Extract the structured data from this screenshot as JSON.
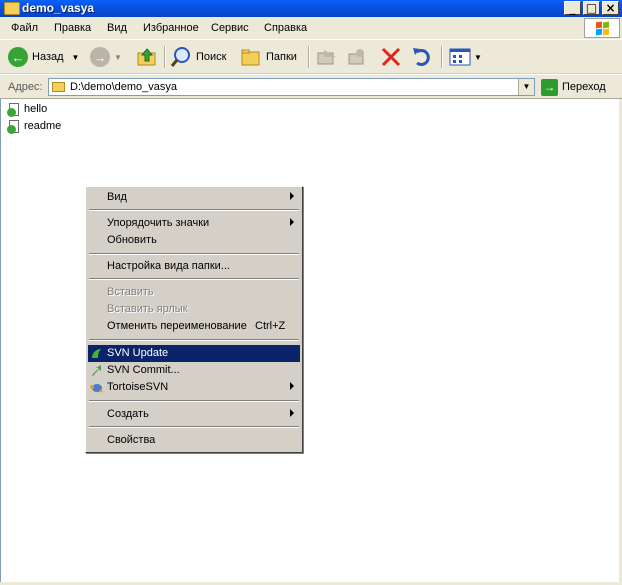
{
  "window": {
    "title": "demo_vasya"
  },
  "menubar": {
    "items": [
      "Файл",
      "Правка",
      "Вид",
      "Избранное",
      "Сервис",
      "Справка"
    ]
  },
  "toolbar": {
    "back_label": "Назад",
    "search_label": "Поиск",
    "folders_label": "Папки"
  },
  "address": {
    "label": "Адрес:",
    "value": "D:\\demo\\demo_vasya",
    "go_label": "Переход"
  },
  "files": [
    {
      "name": "hello"
    },
    {
      "name": "readme"
    }
  ],
  "context_menu": {
    "view": "Вид",
    "arrange_icons": "Упорядочить значки",
    "refresh": "Обновить",
    "customize_folder": "Настройка вида папки...",
    "paste": "Вставить",
    "paste_shortcut": "Вставить ярлык",
    "undo_rename": "Отменить переименование",
    "undo_shortcut": "Ctrl+Z",
    "svn_update": "SVN Update",
    "svn_commit": "SVN Commit...",
    "tortoise": "TortoiseSVN",
    "new": "Создать",
    "properties": "Свойства"
  },
  "colors": {
    "title_bar": "#0852e0",
    "menu_highlight": "#0a246a",
    "menu_bg": "#d4d0c8",
    "chrome_bg": "#ece9d8"
  }
}
